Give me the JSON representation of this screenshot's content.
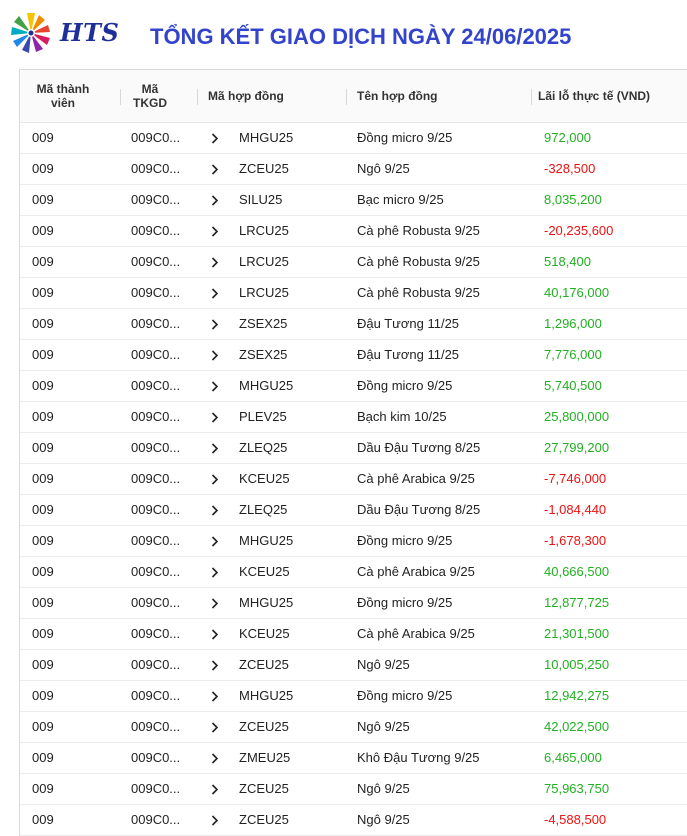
{
  "header": {
    "logo_text": "HTS",
    "title": "TỔNG KẾT GIAO DỊCH NGÀY 24/06/2025"
  },
  "table": {
    "columns": {
      "member_line1": "Mã thành",
      "member_line2": "viên",
      "tkgd_line1": "Mã",
      "tkgd_line2": "TKGD",
      "contract_code": "Mã hợp đồng",
      "contract_name": "Tên hợp đồng",
      "pnl": "Lãi lỗ thực tế (VND)"
    },
    "rows": [
      {
        "member": "009",
        "tkgd": "009C0...",
        "code": "MHGU25",
        "name": "Đồng micro 9/25",
        "pnl": "972,000",
        "sign": "pos"
      },
      {
        "member": "009",
        "tkgd": "009C0...",
        "code": "ZCEU25",
        "name": "Ngô 9/25",
        "pnl": "-328,500",
        "sign": "neg"
      },
      {
        "member": "009",
        "tkgd": "009C0...",
        "code": "SILU25",
        "name": "Bạc micro 9/25",
        "pnl": "8,035,200",
        "sign": "pos"
      },
      {
        "member": "009",
        "tkgd": "009C0...",
        "code": "LRCU25",
        "name": "Cà phê Robusta 9/25",
        "pnl": "-20,235,600",
        "sign": "neg"
      },
      {
        "member": "009",
        "tkgd": "009C0...",
        "code": "LRCU25",
        "name": "Cà phê Robusta 9/25",
        "pnl": "518,400",
        "sign": "pos"
      },
      {
        "member": "009",
        "tkgd": "009C0...",
        "code": "LRCU25",
        "name": "Cà phê Robusta 9/25",
        "pnl": "40,176,000",
        "sign": "pos"
      },
      {
        "member": "009",
        "tkgd": "009C0...",
        "code": "ZSEX25",
        "name": "Đậu Tương 11/25",
        "pnl": "1,296,000",
        "sign": "pos"
      },
      {
        "member": "009",
        "tkgd": "009C0...",
        "code": "ZSEX25",
        "name": "Đậu Tương 11/25",
        "pnl": "7,776,000",
        "sign": "pos"
      },
      {
        "member": "009",
        "tkgd": "009C0...",
        "code": "MHGU25",
        "name": "Đồng micro 9/25",
        "pnl": "5,740,500",
        "sign": "pos"
      },
      {
        "member": "009",
        "tkgd": "009C0...",
        "code": "PLEV25",
        "name": "Bạch kim 10/25",
        "pnl": "25,800,000",
        "sign": "pos"
      },
      {
        "member": "009",
        "tkgd": "009C0...",
        "code": "ZLEQ25",
        "name": "Dầu Đậu Tương 8/25",
        "pnl": "27,799,200",
        "sign": "pos"
      },
      {
        "member": "009",
        "tkgd": "009C0...",
        "code": "KCEU25",
        "name": "Cà phê Arabica 9/25",
        "pnl": "-7,746,000",
        "sign": "neg"
      },
      {
        "member": "009",
        "tkgd": "009C0...",
        "code": "ZLEQ25",
        "name": "Dầu Đậu Tương 8/25",
        "pnl": "-1,084,440",
        "sign": "neg"
      },
      {
        "member": "009",
        "tkgd": "009C0...",
        "code": "MHGU25",
        "name": "Đồng micro 9/25",
        "pnl": "-1,678,300",
        "sign": "neg"
      },
      {
        "member": "009",
        "tkgd": "009C0...",
        "code": "KCEU25",
        "name": "Cà phê Arabica 9/25",
        "pnl": "40,666,500",
        "sign": "pos"
      },
      {
        "member": "009",
        "tkgd": "009C0...",
        "code": "MHGU25",
        "name": "Đồng micro 9/25",
        "pnl": "12,877,725",
        "sign": "pos"
      },
      {
        "member": "009",
        "tkgd": "009C0...",
        "code": "KCEU25",
        "name": "Cà phê Arabica 9/25",
        "pnl": "21,301,500",
        "sign": "pos"
      },
      {
        "member": "009",
        "tkgd": "009C0...",
        "code": "ZCEU25",
        "name": "Ngô 9/25",
        "pnl": "10,005,250",
        "sign": "pos"
      },
      {
        "member": "009",
        "tkgd": "009C0...",
        "code": "MHGU25",
        "name": "Đồng micro 9/25",
        "pnl": "12,942,275",
        "sign": "pos"
      },
      {
        "member": "009",
        "tkgd": "009C0...",
        "code": "ZCEU25",
        "name": "Ngô 9/25",
        "pnl": "42,022,500",
        "sign": "pos"
      },
      {
        "member": "009",
        "tkgd": "009C0...",
        "code": "ZMEU25",
        "name": "Khô Đậu Tương 9/25",
        "pnl": "6,465,000",
        "sign": "pos"
      },
      {
        "member": "009",
        "tkgd": "009C0...",
        "code": "ZCEU25",
        "name": "Ngô 9/25",
        "pnl": "75,963,750",
        "sign": "pos"
      },
      {
        "member": "009",
        "tkgd": "009C0...",
        "code": "ZCEU25",
        "name": "Ngô 9/25",
        "pnl": "-4,588,500",
        "sign": "neg"
      }
    ]
  },
  "colors": {
    "title": "#3344cc",
    "logo_text": "#1f2f9a",
    "positive": "#22b022",
    "negative": "#ee1111"
  }
}
